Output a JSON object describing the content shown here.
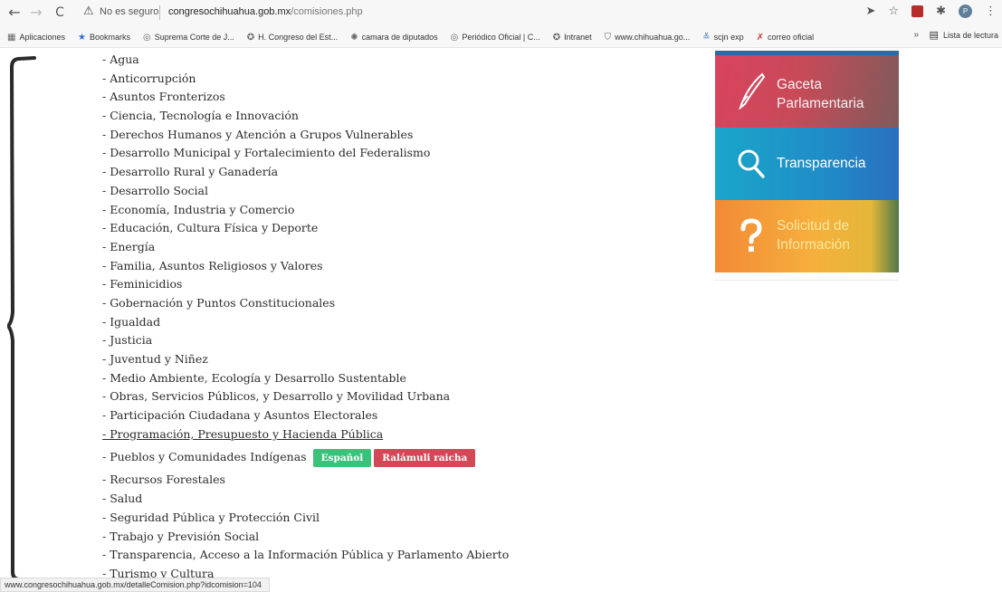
{
  "browser": {
    "nav": {
      "back": "←",
      "forward": "→",
      "reload": "C"
    },
    "security_icon": "warning-triangle-icon",
    "security_text": "No es seguro",
    "url_host": "congresochihuahua.gob.mx",
    "url_path": "/comisiones.php",
    "right_icons": [
      "share-icon",
      "star-icon",
      "pdf-extension-icon",
      "puzzle-extension-icon",
      "profile-avatar-icon",
      "menu-icon"
    ],
    "avatar_initial": "P",
    "bookmarks": [
      {
        "label": "Aplicaciones",
        "icon": "apps-grid-icon"
      },
      {
        "label": "Bookmarks",
        "icon": "star-icon"
      },
      {
        "label": "Suprema Corte de J...",
        "icon": "globe-icon"
      },
      {
        "label": "H. Congreso del Est...",
        "icon": "congreso-icon"
      },
      {
        "label": "camara de diputados",
        "icon": "camara-icon"
      },
      {
        "label": "Periódico Oficial | C...",
        "icon": "globe-icon"
      },
      {
        "label": "Intranet",
        "icon": "congreso-icon"
      },
      {
        "label": "www.chihuahua.go...",
        "icon": "shield-icon"
      },
      {
        "label": "scjn exp",
        "icon": "scjn-icon"
      },
      {
        "label": "correo oficial",
        "icon": "x-mail-icon"
      }
    ],
    "bookmarks_more": "»",
    "reading_list": "Lista de lectura"
  },
  "commissions": [
    "- Agua",
    "- Anticorrupción",
    "- Asuntos Fronterizos",
    "- Ciencia, Tecnología e Innovación",
    "- Derechos Humanos y Atención a Grupos Vulnerables",
    "- Desarrollo Municipal y Fortalecimiento del Federalismo",
    "- Desarrollo Rural y Ganadería",
    "- Desarrollo Social",
    "- Economía, Industria y Comercio",
    "- Educación, Cultura Física y Deporte",
    "- Energía",
    "- Familia, Asuntos Religiosos y Valores",
    "- Feminicidios",
    "- Gobernación y Puntos Constitucionales",
    "- Igualdad",
    "- Justicia",
    "- Juventud y Niñez",
    "- Medio Ambiente, Ecología y Desarrollo Sustentable",
    "- Obras, Servicios Públicos, y Desarrollo y Movilidad Urbana",
    "- Participación Ciudadana y Asuntos Electorales",
    "- Programación, Presupuesto y Hacienda Pública",
    "- Pueblos y Comunidades Indígenas",
    "- Recursos Forestales",
    "- Salud",
    "- Seguridad Pública y Protección Civil",
    "- Trabajo y Previsión Social",
    "- Transparencia, Acceso a la Información Pública y Parlamento Abierto",
    "- Turismo y Cultura"
  ],
  "hovered_commission": "- Programación, Presupuesto y Hacienda Pública",
  "language_buttons": {
    "spanish": "Español",
    "raramuri": "Ralámuli raicha"
  },
  "banners": {
    "gaceta": {
      "line1": "Gaceta",
      "line2": "Parlamentaria",
      "icon": "pen-nib-icon"
    },
    "transparencia": {
      "label": "Transparencia",
      "icon": "search-icon"
    },
    "solicitud": {
      "line1": "Solicitud de",
      "line2": "Información",
      "icon": "question-mark-icon"
    }
  },
  "status_url": "www.congresochihuahua.gob.mx/detalleComision.php?idcomision=104"
}
